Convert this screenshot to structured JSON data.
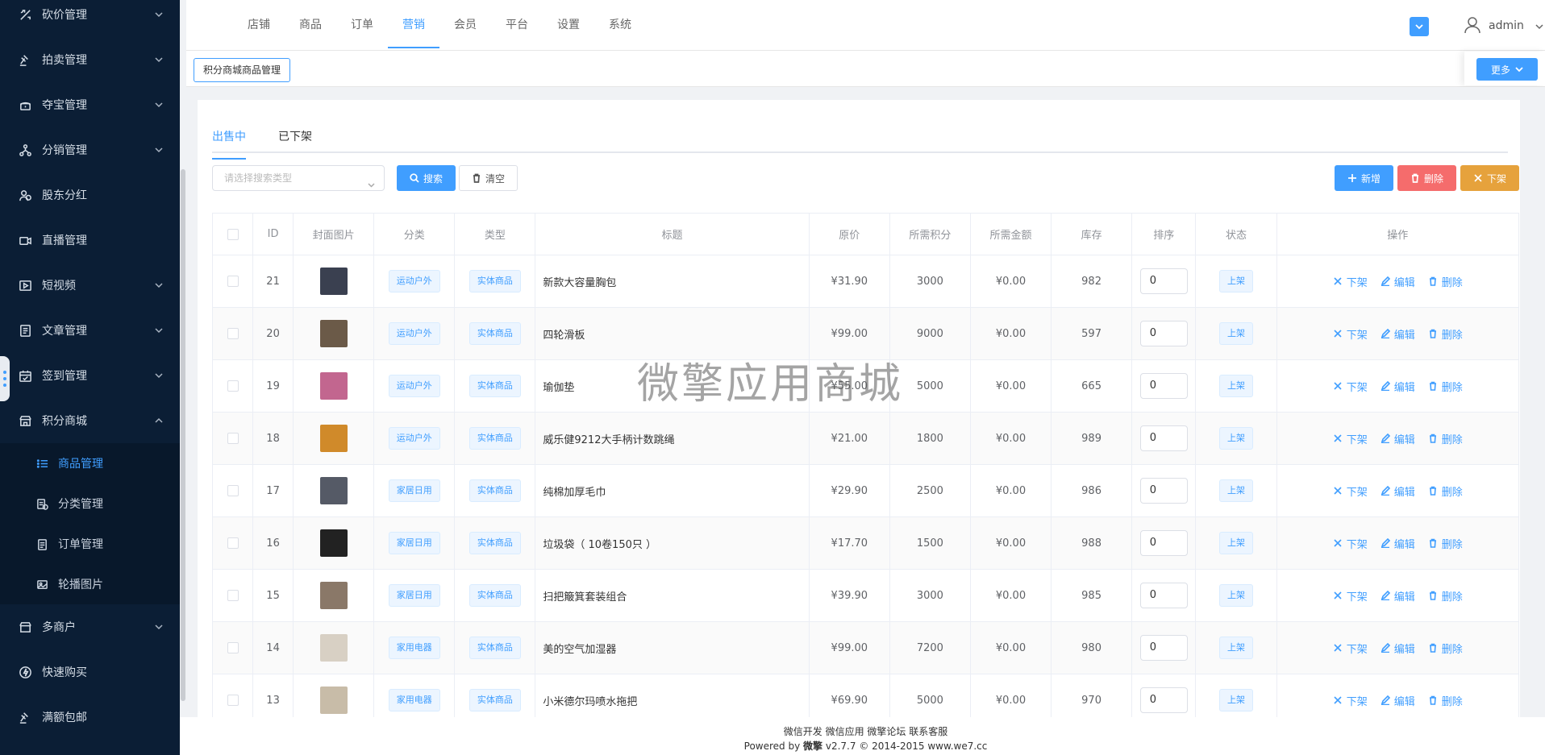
{
  "sidebar": {
    "items_top": [
      {
        "label": "砍价管理",
        "icon": "bargain-icon"
      },
      {
        "label": "拍卖管理",
        "icon": "auction-icon"
      },
      {
        "label": "夺宝管理",
        "icon": "treasure-icon"
      },
      {
        "label": "分销管理",
        "icon": "distribution-icon"
      },
      {
        "label": "股东分红",
        "icon": "shareholder-icon"
      },
      {
        "label": "直播管理",
        "icon": "live-icon"
      },
      {
        "label": "短视频",
        "icon": "video-icon"
      },
      {
        "label": "文章管理",
        "icon": "article-icon"
      },
      {
        "label": "签到管理",
        "icon": "calendar-icon"
      },
      {
        "label": "积分商城",
        "icon": "store-icon"
      }
    ],
    "submenu": [
      {
        "label": "商品管理",
        "icon": "list-icon"
      },
      {
        "label": "分类管理",
        "icon": "category-icon"
      },
      {
        "label": "订单管理",
        "icon": "order-icon"
      },
      {
        "label": "轮播图片",
        "icon": "image-icon"
      }
    ],
    "items_bottom": [
      {
        "label": "多商户",
        "icon": "merchant-icon"
      },
      {
        "label": "快速购买",
        "icon": "lightning-icon"
      },
      {
        "label": "满额包邮",
        "icon": "shipping-icon"
      }
    ]
  },
  "topnav": {
    "tabs": [
      "店铺",
      "商品",
      "订单",
      "营销",
      "会员",
      "平台",
      "设置",
      "系统"
    ],
    "active_tab": "营销",
    "user": "admin"
  },
  "crumb": {
    "button": "积分商城商品管理",
    "more": "更多"
  },
  "subtabs": [
    "出售中",
    "已下架"
  ],
  "toolbar": {
    "select_placeholder": "请选择搜索类型",
    "search": "搜索",
    "clear": "清空",
    "add": "新增",
    "delete": "删除",
    "offline": "下架"
  },
  "table": {
    "headers": [
      "ID",
      "封面图片",
      "分类",
      "类型",
      "标题",
      "原价",
      "所需积分",
      "所需金额",
      "库存",
      "排序",
      "状态",
      "操作"
    ],
    "rows": [
      {
        "id": "21",
        "category": "运动户外",
        "type": "实体商品",
        "title": "新款大容量胸包",
        "price": "¥31.90",
        "points": "3000",
        "amount": "¥0.00",
        "stock": "982",
        "sort": "0",
        "status": "上架",
        "thumb_color": "#3a4050"
      },
      {
        "id": "20",
        "category": "运动户外",
        "type": "实体商品",
        "title": "四轮滑板",
        "price": "¥99.00",
        "points": "9000",
        "amount": "¥0.00",
        "stock": "597",
        "sort": "0",
        "status": "上架",
        "thumb_color": "#6b5a48"
      },
      {
        "id": "19",
        "category": "运动户外",
        "type": "实体商品",
        "title": "瑜伽垫",
        "price": "¥55.00",
        "points": "5000",
        "amount": "¥0.00",
        "stock": "665",
        "sort": "0",
        "status": "上架",
        "thumb_color": "#c2668f"
      },
      {
        "id": "18",
        "category": "运动户外",
        "type": "实体商品",
        "title": "威乐健9212大手柄计数跳绳",
        "price": "¥21.00",
        "points": "1800",
        "amount": "¥0.00",
        "stock": "989",
        "sort": "0",
        "status": "上架",
        "thumb_color": "#d08a2a"
      },
      {
        "id": "17",
        "category": "家居日用",
        "type": "实体商品",
        "title": "纯棉加厚毛巾",
        "price": "¥29.90",
        "points": "2500",
        "amount": "¥0.00",
        "stock": "986",
        "sort": "0",
        "status": "上架",
        "thumb_color": "#555a66"
      },
      {
        "id": "16",
        "category": "家居日用",
        "type": "实体商品",
        "title": "垃圾袋（ 10卷150只 ）",
        "price": "¥17.70",
        "points": "1500",
        "amount": "¥0.00",
        "stock": "988",
        "sort": "0",
        "status": "上架",
        "thumb_color": "#222222"
      },
      {
        "id": "15",
        "category": "家居日用",
        "type": "实体商品",
        "title": "扫把簸箕套装组合",
        "price": "¥39.90",
        "points": "3000",
        "amount": "¥0.00",
        "stock": "985",
        "sort": "0",
        "status": "上架",
        "thumb_color": "#8a7868"
      },
      {
        "id": "14",
        "category": "家用电器",
        "type": "实体商品",
        "title": "美的空气加湿器",
        "price": "¥99.00",
        "points": "7200",
        "amount": "¥0.00",
        "stock": "980",
        "sort": "0",
        "status": "上架",
        "thumb_color": "#d8d0c4"
      },
      {
        "id": "13",
        "category": "家用电器",
        "type": "实体商品",
        "title": "小米德尔玛喷水拖把",
        "price": "¥69.90",
        "points": "5000",
        "amount": "¥0.00",
        "stock": "970",
        "sort": "0",
        "status": "上架",
        "thumb_color": "#c8bca8"
      }
    ],
    "ops": {
      "offline": "下架",
      "edit": "编辑",
      "delete": "删除"
    }
  },
  "watermark": "微擎应用商城",
  "footer": {
    "links": "微信开发 微信应用 微擎论坛 联系客服",
    "powered_prefix": "Powered by",
    "brand": "微擎",
    "powered_suffix": "v2.7.7 © 2014-2015 www.we7.cc"
  }
}
